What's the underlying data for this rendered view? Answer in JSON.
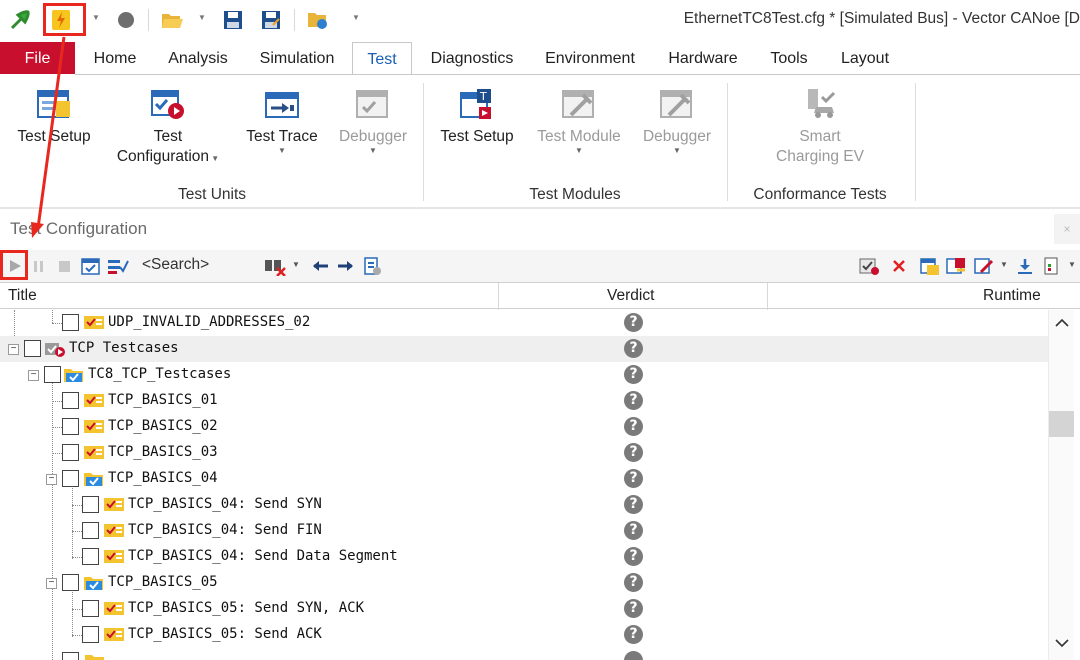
{
  "window": {
    "title": "EthernetTC8Test.cfg * [Simulated Bus] - Vector CANoe [D"
  },
  "menu": {
    "tabs": [
      "File",
      "Home",
      "Analysis",
      "Simulation",
      "Test",
      "Diagnostics",
      "Environment",
      "Hardware",
      "Tools",
      "Layout"
    ],
    "active": "Test"
  },
  "ribbon": {
    "test_units": {
      "label": "Test Units",
      "buttons": [
        {
          "line1": "Test Setup",
          "line2": ""
        },
        {
          "line1": "Test",
          "line2": "Configuration"
        },
        {
          "line1": "Test Trace",
          "line2": ""
        },
        {
          "line1": "Debugger",
          "line2": ""
        }
      ]
    },
    "test_modules": {
      "label": "Test Modules",
      "buttons": [
        {
          "line1": "Test Setup",
          "line2": ""
        },
        {
          "line1": "Test Module",
          "line2": ""
        },
        {
          "line1": "Debugger",
          "line2": ""
        }
      ]
    },
    "conformance": {
      "label": "Conformance Tests",
      "buttons": [
        {
          "line1": "Smart",
          "line2": "Charging EV"
        }
      ]
    }
  },
  "panel": {
    "title": "Test Configuration",
    "close_glyph": "×",
    "search_placeholder": "<Search>"
  },
  "grid": {
    "columns": {
      "title": "Title",
      "verdict": "Verdict",
      "runtime": "Runtime"
    },
    "rows": [
      {
        "text": "UDP_INVALID_ADDRESSES_02",
        "verdict": "?"
      },
      {
        "text": "TCP Testcases",
        "verdict": "?"
      },
      {
        "text": "TC8_TCP_Testcases",
        "verdict": "?"
      },
      {
        "text": "TCP_BASICS_01",
        "verdict": "?"
      },
      {
        "text": "TCP_BASICS_02",
        "verdict": "?"
      },
      {
        "text": "TCP_BASICS_03",
        "verdict": "?"
      },
      {
        "text": "TCP_BASICS_04",
        "verdict": "?"
      },
      {
        "text": "TCP_BASICS_04: Send SYN",
        "verdict": "?"
      },
      {
        "text": "TCP_BASICS_04: Send FIN",
        "verdict": "?"
      },
      {
        "text": "TCP_BASICS_04: Send Data Segment",
        "verdict": "?"
      },
      {
        "text": "TCP_BASICS_05",
        "verdict": "?"
      },
      {
        "text": "TCP_BASICS_05: Send SYN, ACK",
        "verdict": "?"
      },
      {
        "text": "TCP_BASICS_05: Send ACK",
        "verdict": "?"
      }
    ]
  },
  "icons": {
    "qat": [
      "start-green-icon",
      "lightning-start-icon",
      "stop-circle-icon",
      "open-folder-icon",
      "save-icon",
      "save-as-icon",
      "config-icon"
    ],
    "panel_toolbar": [
      "run-icon",
      "pause-icon",
      "stop-icon",
      "calendar-check-icon",
      "checklist-icon",
      "binoculars-filter-icon",
      "arrow-left-icon",
      "arrow-right-icon",
      "report-icon",
      "add-check-icon",
      "delete-icon",
      "copy-icon",
      "export-icon",
      "edit-icon",
      "download-icon",
      "document-icon"
    ]
  },
  "colors": {
    "accent_red": "#c8102e",
    "annotation": "#e8281e",
    "active_tab_text": "#1a5fb4"
  }
}
